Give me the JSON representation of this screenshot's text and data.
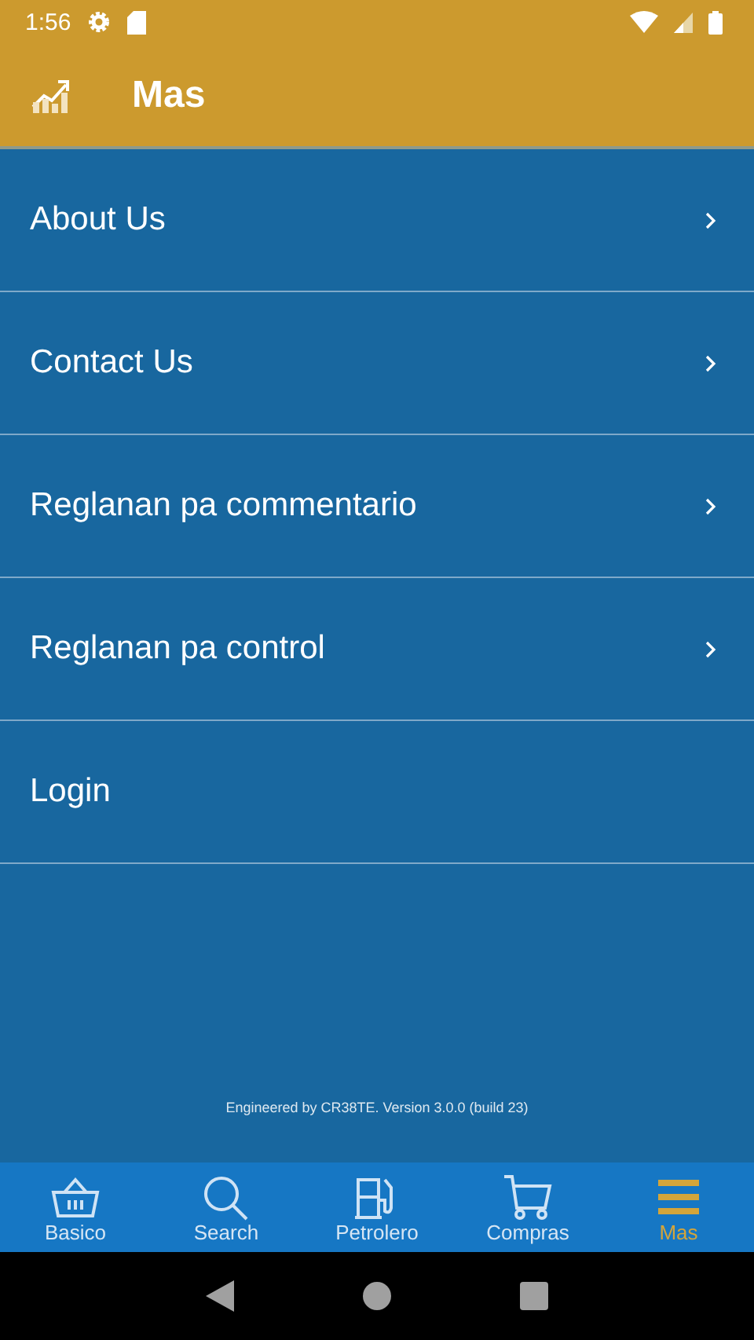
{
  "status_bar": {
    "time": "1:56"
  },
  "app_bar": {
    "title": "Mas"
  },
  "menu": [
    {
      "label": "About Us",
      "chevron": true
    },
    {
      "label": "Contact Us",
      "chevron": true
    },
    {
      "label": "Reglanan pa commentario",
      "chevron": true
    },
    {
      "label": "Reglanan pa control",
      "chevron": true
    },
    {
      "label": "Login",
      "chevron": false
    }
  ],
  "footer": "Engineered by CR38TE. Version 3.0.0 (build 23)",
  "bottom_nav": [
    {
      "label": "Basico",
      "selected": false
    },
    {
      "label": "Search",
      "selected": false
    },
    {
      "label": "Petrolero",
      "selected": false
    },
    {
      "label": "Compras",
      "selected": false
    },
    {
      "label": "Mas",
      "selected": true
    }
  ]
}
